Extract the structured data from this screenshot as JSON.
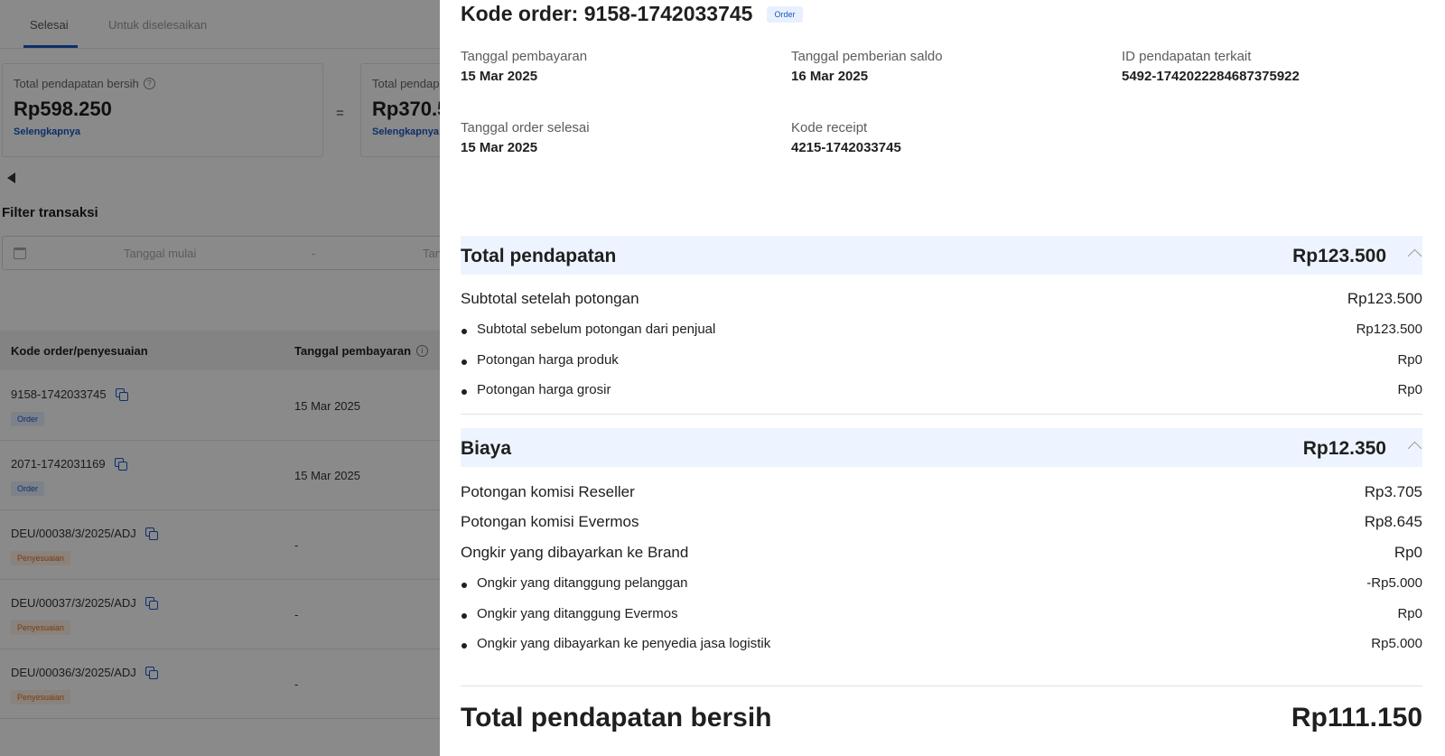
{
  "background": {
    "tabs": [
      {
        "label": "Selesai",
        "active": true
      },
      {
        "label": "Untuk diselesaikan",
        "active": false
      }
    ],
    "stats": [
      {
        "label": "Total pendapatan bersih",
        "value": "Rp598.250",
        "link": "Selengkapnya"
      },
      {
        "label": "Total pendap",
        "value": "Rp370.5",
        "link": "Selengkapnya"
      }
    ],
    "equals": "=",
    "filter": {
      "title": "Filter transaksi",
      "start_placeholder": "Tanggal mulai",
      "separator": "-",
      "end_placeholder": "Tan"
    },
    "table": {
      "columns": [
        "Kode order/penyesuaian",
        "Tanggal pembayaran"
      ],
      "rows": [
        {
          "code": "9158-1742033745",
          "tag": "Order",
          "date": "15 Mar 2025"
        },
        {
          "code": "2071-1742031169",
          "tag": "Order",
          "date": "15 Mar 2025"
        },
        {
          "code": "DEU/00038/3/2025/ADJ",
          "tag": "Penyesuaian",
          "date": "-"
        },
        {
          "code": "DEU/00037/3/2025/ADJ",
          "tag": "Penyesuaian",
          "date": "-"
        },
        {
          "code": "DEU/00036/3/2025/ADJ",
          "tag": "Penyesuaian",
          "date": "-"
        }
      ]
    }
  },
  "drawer": {
    "title": "Kode order: 9158-1742033745",
    "badge": "Order",
    "meta": [
      {
        "label": "Tanggal pembayaran",
        "value": "15 Mar 2025"
      },
      {
        "label": "Tanggal pemberian saldo",
        "value": "16 Mar 2025"
      },
      {
        "label": "ID pendapatan terkait",
        "value": "5492-1742022284687375922"
      },
      {
        "label": "Tanggal order selesai",
        "value": "15 Mar 2025"
      },
      {
        "label": "Kode receipt",
        "value": "4215-1742033745"
      }
    ],
    "revenue": {
      "title": "Total pendapatan",
      "amount": "Rp123.500",
      "lines": [
        {
          "label": "Subtotal setelah potongan",
          "value": "Rp123.500"
        },
        {
          "label": "Subtotal sebelum potongan dari penjual",
          "value": "Rp123.500"
        },
        {
          "label": "Potongan harga produk",
          "value": "Rp0"
        },
        {
          "label": "Potongan harga grosir",
          "value": "Rp0"
        }
      ]
    },
    "fees": {
      "title": "Biaya",
      "amount": "Rp12.350",
      "lines": [
        {
          "label": "Potongan komisi Reseller",
          "value": "Rp3.705"
        },
        {
          "label": "Potongan komisi Evermos",
          "value": "Rp8.645"
        },
        {
          "label": "Ongkir yang dibayarkan ke Brand",
          "value": "Rp0"
        },
        {
          "label": "Ongkir yang ditanggung pelanggan",
          "value": "-Rp5.000"
        },
        {
          "label": "Ongkir yang ditanggung Evermos",
          "value": "Rp0"
        },
        {
          "label": "Ongkir yang dibayarkan ke penyedia jasa logistik",
          "value": "Rp5.000"
        }
      ]
    },
    "net": {
      "label": "Total pendapatan bersih",
      "value": "Rp111.150"
    }
  }
}
